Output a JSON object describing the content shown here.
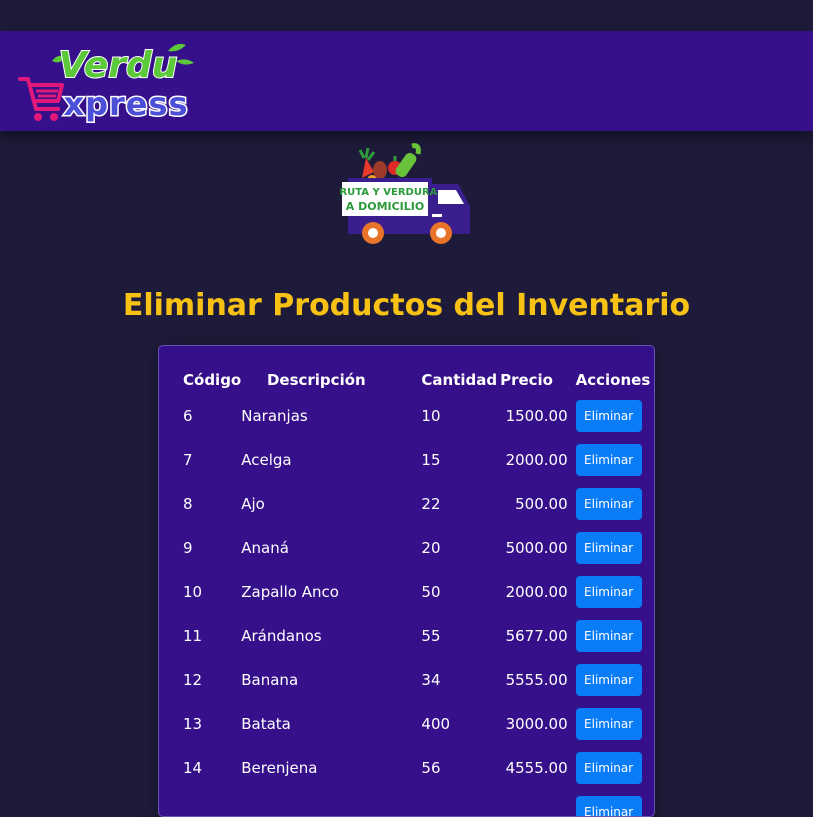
{
  "header": {
    "logo_top": "Verdu",
    "logo_bottom": "xpress",
    "logo_alt": "VerduExpress logo"
  },
  "banner": {
    "truck_text_line1": "FRUTA Y VERDURA",
    "truck_text_line2": "A DOMICILIO"
  },
  "page": {
    "title": "Eliminar Productos del Inventario"
  },
  "table": {
    "headers": [
      "Código",
      "Descripción",
      "Cantidad",
      "Precio",
      "Acciones"
    ],
    "delete_label": "Eliminar",
    "rows": [
      {
        "code": "6",
        "description": "Naranjas",
        "quantity": "10",
        "price": "1500.00"
      },
      {
        "code": "7",
        "description": "Acelga",
        "quantity": "15",
        "price": "2000.00"
      },
      {
        "code": "8",
        "description": "Ajo",
        "quantity": "22",
        "price": "500.00"
      },
      {
        "code": "9",
        "description": "Ananá",
        "quantity": "20",
        "price": "5000.00"
      },
      {
        "code": "10",
        "description": "Zapallo Anco",
        "quantity": "50",
        "price": "2000.00"
      },
      {
        "code": "11",
        "description": "Arándanos",
        "quantity": "55",
        "price": "5677.00"
      },
      {
        "code": "12",
        "description": "Banana",
        "quantity": "34",
        "price": "5555.00"
      },
      {
        "code": "13",
        "description": "Batata",
        "quantity": "400",
        "price": "3000.00"
      },
      {
        "code": "14",
        "description": "Berenjena",
        "quantity": "56",
        "price": "4555.00"
      },
      {
        "code": "",
        "description": "",
        "quantity": "",
        "price": ""
      }
    ]
  },
  "colors": {
    "background": "#1e1b3a",
    "header": "#36108a",
    "title": "#f7c214",
    "button": "#0a7cf6"
  }
}
